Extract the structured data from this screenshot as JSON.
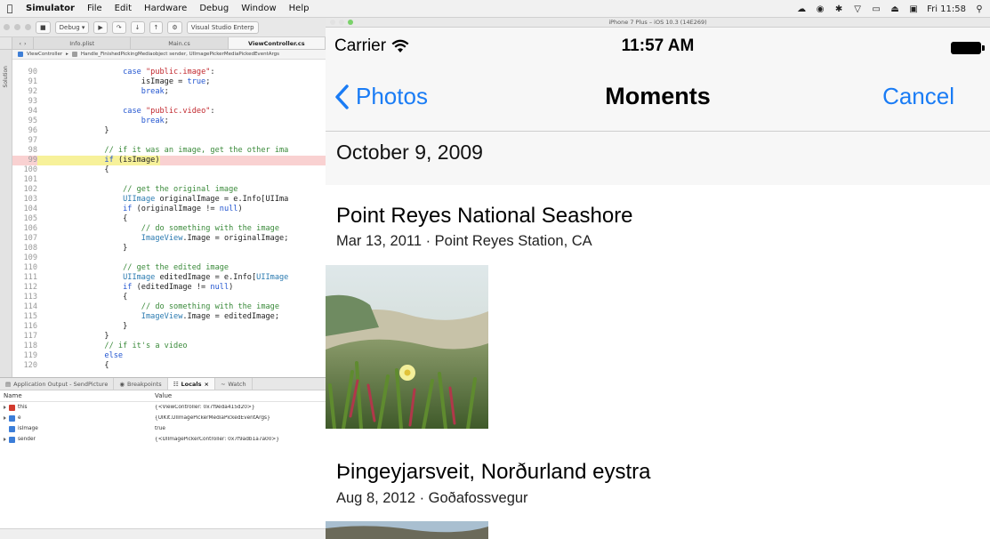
{
  "menubar": {
    "app": "Simulator",
    "items": [
      "File",
      "Edit",
      "Hardware",
      "Debug",
      "Window",
      "Help"
    ],
    "clock": "Fri 11:58"
  },
  "ide": {
    "toolbar": {
      "config": "Debug",
      "product": "Visual Studio Enterp"
    },
    "tabs": [
      "Info.plist",
      "Main.cs",
      "ViewController.cs"
    ],
    "breadcrumb": {
      "class": "ViewController",
      "method": "Handle_FinishedPickingMediaobject sender, UIImagePickerMediaPickedEventArgs"
    },
    "sidebar_label": "Solution",
    "code_lines": [
      {
        "n": "90",
        "t": "            case \"public.image\":",
        "hl": false
      },
      {
        "n": "91",
        "t": "                isImage = true;",
        "hl": false
      },
      {
        "n": "92",
        "t": "                break;",
        "hl": false
      },
      {
        "n": "93",
        "t": "",
        "hl": false
      },
      {
        "n": "94",
        "t": "            case \"public.video\":",
        "hl": false
      },
      {
        "n": "95",
        "t": "                break;",
        "hl": false
      },
      {
        "n": "96",
        "t": "        }",
        "hl": false
      },
      {
        "n": "97",
        "t": "",
        "hl": false
      },
      {
        "n": "98",
        "t": "        // if it was an image, get the other ima",
        "hl": false
      },
      {
        "n": "99",
        "t": "        if (isImage)",
        "hl": true
      },
      {
        "n": "100",
        "t": "        {",
        "hl": false
      },
      {
        "n": "101",
        "t": "",
        "hl": false
      },
      {
        "n": "102",
        "t": "            // get the original image",
        "hl": false
      },
      {
        "n": "103",
        "t": "            UIImage originalImage = e.Info[UIIma",
        "hl": false
      },
      {
        "n": "104",
        "t": "            if (originalImage != null)",
        "hl": false
      },
      {
        "n": "105",
        "t": "            {",
        "hl": false
      },
      {
        "n": "106",
        "t": "                // do something with the image",
        "hl": false
      },
      {
        "n": "107",
        "t": "                ImageView.Image = originalImage;",
        "hl": false
      },
      {
        "n": "108",
        "t": "            }",
        "hl": false
      },
      {
        "n": "109",
        "t": "",
        "hl": false
      },
      {
        "n": "110",
        "t": "            // get the edited image",
        "hl": false
      },
      {
        "n": "111",
        "t": "            UIImage editedImage = e.Info[UIImage",
        "hl": false
      },
      {
        "n": "112",
        "t": "            if (editedImage != null)",
        "hl": false
      },
      {
        "n": "113",
        "t": "            {",
        "hl": false
      },
      {
        "n": "114",
        "t": "                // do something with the image",
        "hl": false
      },
      {
        "n": "115",
        "t": "                ImageView.Image = editedImage;",
        "hl": false
      },
      {
        "n": "116",
        "t": "            }",
        "hl": false
      },
      {
        "n": "117",
        "t": "        }",
        "hl": false
      },
      {
        "n": "118",
        "t": "        // if it's a video",
        "hl": false
      },
      {
        "n": "119",
        "t": "        else",
        "hl": false
      },
      {
        "n": "120",
        "t": "        {",
        "hl": false
      }
    ],
    "panel": {
      "tabs": [
        "Application Output - SendPicture",
        "Breakpoints",
        "Locals",
        "Watch"
      ],
      "columns": [
        "Name",
        "Value"
      ],
      "rows": [
        {
          "name": "this",
          "value": "{<ViewController: 0x7f9eda415d20>}",
          "expand": true,
          "color": "#d23a2e"
        },
        {
          "name": "e",
          "value": "{UIKit.UIImagePickerMediaPickedEventArgs}",
          "expand": true,
          "color": "#3b7dd8"
        },
        {
          "name": "isImage",
          "value": "true",
          "expand": false,
          "color": "#3b7dd8"
        },
        {
          "name": "sender",
          "value": "{<UIImagePickerController: 0x7f9adb1a7a00>}",
          "expand": true,
          "color": "#3b7dd8"
        }
      ]
    }
  },
  "simulator": {
    "window_title": "iPhone 7 Plus – iOS 10.3 (14E269)",
    "status": {
      "carrier": "Carrier",
      "time": "11:57 AM"
    },
    "nav": {
      "back": "Photos",
      "title": "Moments",
      "cancel": "Cancel"
    },
    "section_date": "October 9, 2009",
    "moments": [
      {
        "title": "Point Reyes National Seashore",
        "subtitle": "Mar 13, 2011 · Point Reyes Station, CA"
      },
      {
        "title": "Þingeyjarsveit, Norðurland eystra",
        "subtitle": "Aug 8, 2012 · Goðafossvegur"
      }
    ]
  }
}
